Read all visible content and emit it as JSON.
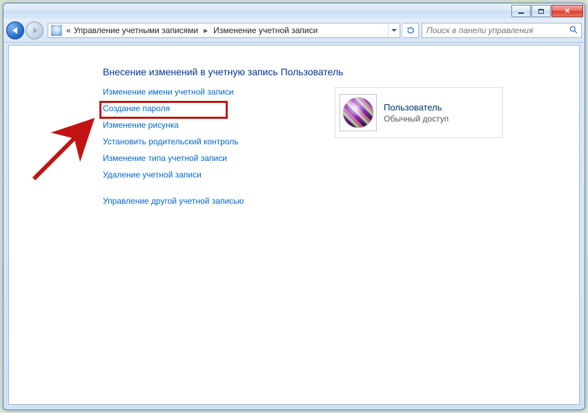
{
  "titlebar": {},
  "navbar": {
    "breadcrumb_trunc": "«",
    "breadcrumb1": "Управление учетными записями",
    "breadcrumb2": "Изменение учетной записи",
    "search_placeholder": "Поиск в панели управления"
  },
  "page": {
    "title": "Внесение изменений в учетную запись Пользователь",
    "links": [
      "Изменение имени учетной записи",
      "Создание пароля",
      "Изменение рисунка",
      "Установить родительский контроль",
      "Изменение типа учетной записи",
      "Удаление учетной записи"
    ],
    "extra_link": "Управление другой учетной записью",
    "account": {
      "name": "Пользователь",
      "type": "Обычный доступ"
    }
  },
  "annotation": {
    "highlighted_index": 1
  }
}
